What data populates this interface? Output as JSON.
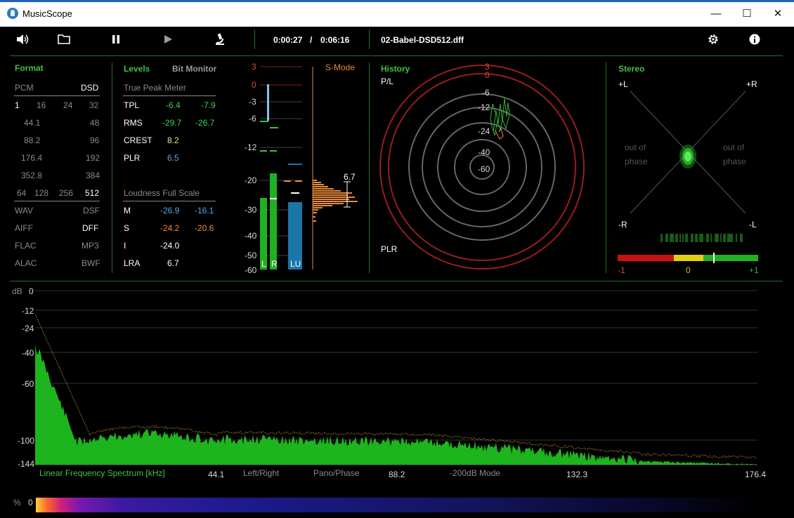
{
  "window": {
    "title": "MusicScope",
    "minimize": "—",
    "maximize": "☐",
    "close": "✕"
  },
  "toolbar": {
    "icons": [
      "speaker-icon",
      "folder-icon",
      "pause-icon",
      "play-icon",
      "microscope-icon",
      "gear-icon",
      "info-icon"
    ],
    "time_current": "0:00:27",
    "time_sep": "/",
    "time_total": "0:06:16",
    "filename": "02-Babel-DSD512.dff"
  },
  "format": {
    "title": "Format",
    "pcm": "PCM",
    "dsd": "DSD",
    "bits": [
      "1",
      "16",
      "24",
      "32"
    ],
    "rates_pcm": [
      "44.1",
      "88.2",
      "176.4",
      "352.8"
    ],
    "rates_dsd": [
      "48",
      "96",
      "192",
      "384"
    ],
    "dsd_multipliers": [
      "64",
      "128",
      "256",
      "512"
    ],
    "files_left": [
      "WAV",
      "AIFF",
      "FLAC",
      "ALAC"
    ],
    "files_right": [
      "DSF",
      "DFF",
      "MP3",
      "BWF"
    ]
  },
  "levels": {
    "title": "Levels",
    "bit_monitor": "Bit Monitor",
    "true_peak_title": "True Peak Meter",
    "rows": [
      {
        "label": "TPL",
        "l": "-6.4",
        "r": "-7.9"
      },
      {
        "label": "RMS",
        "l": "-29.7",
        "r": "-26.7"
      },
      {
        "label": "CREST",
        "l": "8.2",
        "r": ""
      },
      {
        "label": "PLR",
        "l": "6.5",
        "r": ""
      }
    ],
    "loudness_title": "Loudness Full Scale",
    "lrows": [
      {
        "label": "M",
        "a": "-26.9",
        "b": "-16.1"
      },
      {
        "label": "S",
        "a": "-24.2",
        "b": "-20.6"
      },
      {
        "label": "I",
        "a": "-24.0",
        "b": ""
      },
      {
        "label": "LRA",
        "a": "6.7",
        "b": ""
      }
    ]
  },
  "meter": {
    "scale": [
      "3",
      "0",
      "-3",
      "-6",
      "-12",
      "-20",
      "-30",
      "-40",
      "-50",
      "-60"
    ],
    "mode": "S-Mode",
    "labels": [
      "L",
      "R",
      "LU"
    ],
    "lra_value": "6.7",
    "bars_db": {
      "L": -26.5,
      "R": -18.5,
      "LU": -27.0
    }
  },
  "history": {
    "title": "History",
    "pl": "P/L",
    "plr": "PLR",
    "rings": [
      "3",
      "0",
      "-6",
      "-12",
      "-24",
      "-40",
      "-60"
    ]
  },
  "stereo": {
    "title": "Stereo",
    "corners": [
      "+L",
      "+R",
      "-R",
      "-L"
    ],
    "oop_left": [
      "out of",
      "phase"
    ],
    "oop_right": [
      "out of",
      "phase"
    ],
    "corr_labels": [
      "-1",
      "0",
      "+1"
    ],
    "correlation": 0.37,
    "colors": {
      "neg": "#c81212",
      "mid": "#e0d012",
      "pos": "#22b022"
    }
  },
  "spectrum": {
    "db_label": "dB",
    "y_ticks": [
      "0",
      "-12",
      "-24",
      "-40",
      "-60",
      "-100",
      "-144"
    ],
    "x_ticks": [
      "44.1",
      "88.2",
      "132.3",
      "176.4"
    ],
    "title": "Linear Frequency Spectrum [kHz]",
    "modes": [
      "Left/Right",
      "Pano/Phase",
      "-200dB Mode"
    ]
  },
  "bottom": {
    "pct": "%",
    "zero": "0"
  }
}
